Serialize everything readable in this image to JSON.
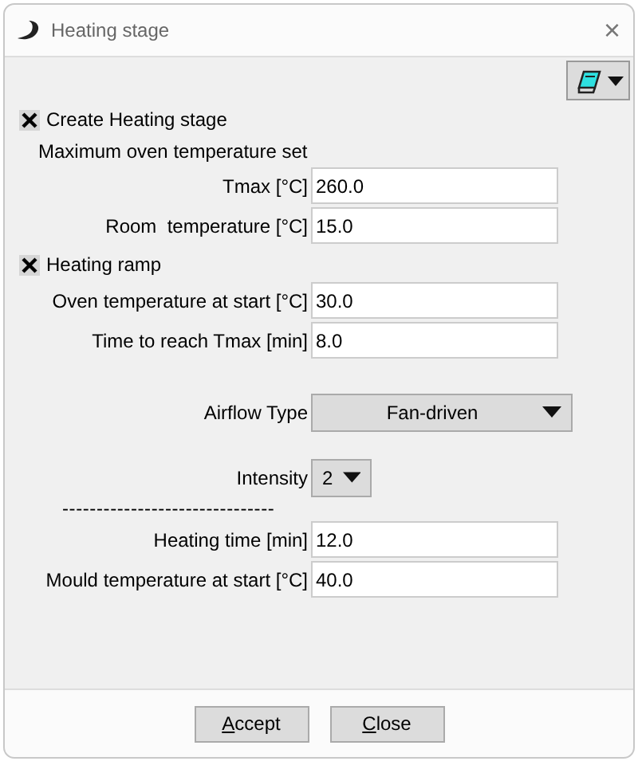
{
  "window": {
    "title": "Heating stage",
    "close": "×"
  },
  "items": [
    {
      "kind": "checkbox",
      "label": "Create Heating stage",
      "checked": true
    },
    {
      "kind": "heading",
      "label": "Maximum oven temperature set"
    },
    {
      "kind": "field",
      "label": "Tmax [°C]",
      "value": "260.0"
    },
    {
      "kind": "field",
      "label": "Room  temperature [°C]",
      "value": "15.0"
    },
    {
      "kind": "checkbox",
      "label": "Heating ramp",
      "checked": true
    },
    {
      "kind": "field",
      "label": "Oven temperature at start [°C]",
      "value": "30.0"
    },
    {
      "kind": "field",
      "label": "Time to reach Tmax [min]",
      "value": "8.0"
    },
    {
      "kind": "dropdown",
      "label": "Airflow Type",
      "value": "Fan-driven"
    },
    {
      "kind": "small_dropdown",
      "label": "Intensity",
      "value": "2"
    },
    {
      "kind": "separator",
      "label": "-------------------------------"
    },
    {
      "kind": "field",
      "label": "Heating time [min]",
      "value": "12.0"
    },
    {
      "kind": "field",
      "label": "Mould temperature at start [°C]",
      "value": "40.0"
    }
  ],
  "buttons": [
    {
      "label": "Accept",
      "underline_first": true
    },
    {
      "label": "Close",
      "underline_first": true
    }
  ]
}
